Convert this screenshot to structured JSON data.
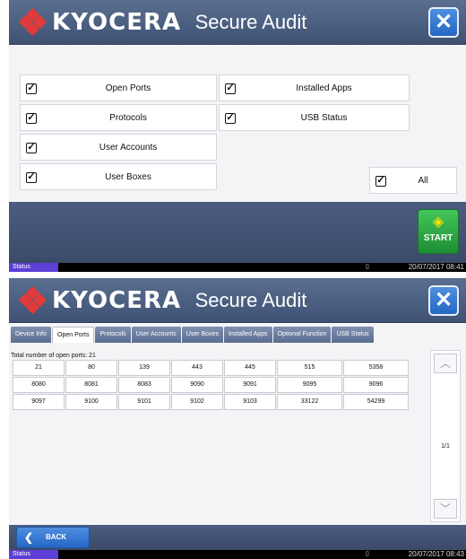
{
  "app": {
    "logo_text": "KYOCERA",
    "title": "Secure Audit",
    "close_symbol": "✕"
  },
  "screen1": {
    "items": [
      {
        "label": "Open Ports",
        "checked": true
      },
      {
        "label": "Protocols",
        "checked": true
      },
      {
        "label": "User Accounts",
        "checked": true
      },
      {
        "label": "User Boxes",
        "checked": true
      },
      {
        "label": "Installed Apps",
        "checked": true
      },
      {
        "label": "USB Status",
        "checked": true
      },
      {
        "label": "All",
        "checked": true
      }
    ],
    "start_label": "START",
    "status_label": "Status",
    "timestamp": "20/07/2017 08:41"
  },
  "screen2": {
    "tabs": [
      "Device Info",
      "Open Ports",
      "Protocols",
      "User Accounts",
      "User Boxes",
      "Installed Apps",
      "Optional Function",
      "USB Status"
    ],
    "active_tab": "Open Ports",
    "total_text": "Total number of open ports: 21",
    "ports": [
      [
        "21",
        "80",
        "139",
        "443",
        "445",
        "515",
        "5358"
      ],
      [
        "8080",
        "8081",
        "8083",
        "9090",
        "9091",
        "9095",
        "9096"
      ],
      [
        "9097",
        "9100",
        "9101",
        "9102",
        "9103",
        "33122",
        "54299"
      ]
    ],
    "page_indicator": "1/1",
    "back_label": "BACK",
    "status_label": "Status",
    "timestamp": "20/07/2017 08:43"
  },
  "colors": {
    "titlebar": "#4a5d80",
    "close_button": "#2f73d0",
    "start_button": "#2da345",
    "status_tab": "#5b3fd6"
  },
  "icons": {
    "close": "close-icon",
    "start": "start-icon",
    "back": "back-arrow-icon",
    "scroll_up": "chevron-up-icon",
    "scroll_down": "chevron-down-icon"
  }
}
